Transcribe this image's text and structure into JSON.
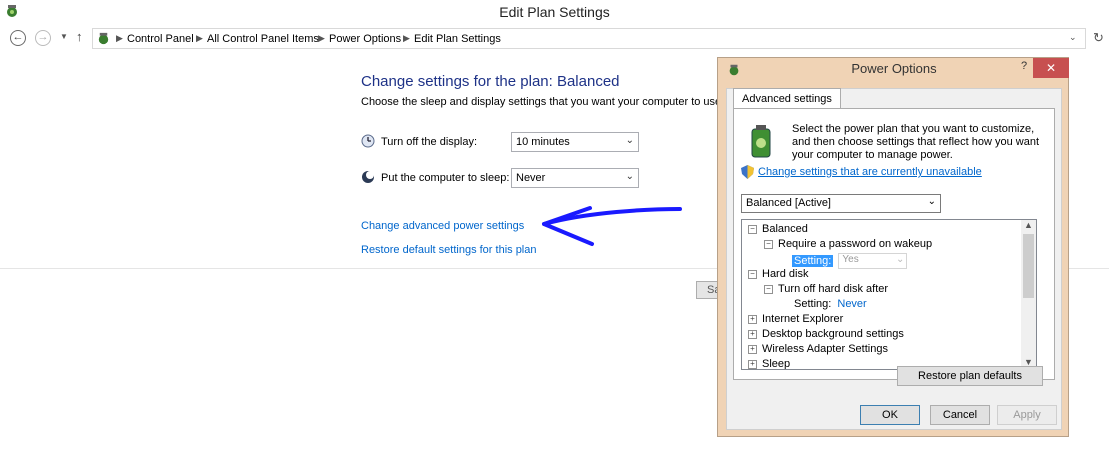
{
  "window": {
    "title": "Edit Plan Settings"
  },
  "breadcrumb": {
    "items": [
      "Control Panel",
      "All Control Panel Items",
      "Power Options",
      "Edit Plan Settings"
    ]
  },
  "main": {
    "heading": "Change settings for the plan: Balanced",
    "description": "Choose the sleep and display settings that you want your computer to use.",
    "display_label": "Turn off the display:",
    "display_value": "10 minutes",
    "sleep_label": "Put the computer to sleep:",
    "sleep_value": "Never",
    "advanced_link": "Change advanced power settings",
    "restore_link": "Restore default settings for this plan",
    "save_partial": "Sa"
  },
  "dialog": {
    "title": "Power Options",
    "help": "?",
    "close": "✕",
    "tab": "Advanced settings",
    "intro": "Select the power plan that you want to customize, and then choose settings that reflect how you want your computer to manage power.",
    "change_link": "Change settings that are currently unavailable",
    "plan_select": "Balanced [Active]",
    "tree": {
      "balanced": "Balanced",
      "require_password": "Require a password on wakeup",
      "setting_label": "Setting:",
      "setting_value": "Yes",
      "hard_disk": "Hard disk",
      "turn_off_hd": "Turn off hard disk after",
      "hd_setting_label": "Setting:",
      "hd_setting_value": "Never",
      "internet_explorer": "Internet Explorer",
      "desktop_background": "Desktop background settings",
      "wireless": "Wireless Adapter Settings",
      "sleep": "Sleep"
    },
    "restore_button": "Restore plan defaults",
    "ok_button": "OK",
    "cancel_button": "Cancel",
    "apply_button": "Apply"
  },
  "colors": {
    "heading": "#1e3287",
    "link": "#0066cc",
    "annotation": "#1a1aff",
    "dialog_frame": "#f0d3b5",
    "close": "#c75050"
  }
}
